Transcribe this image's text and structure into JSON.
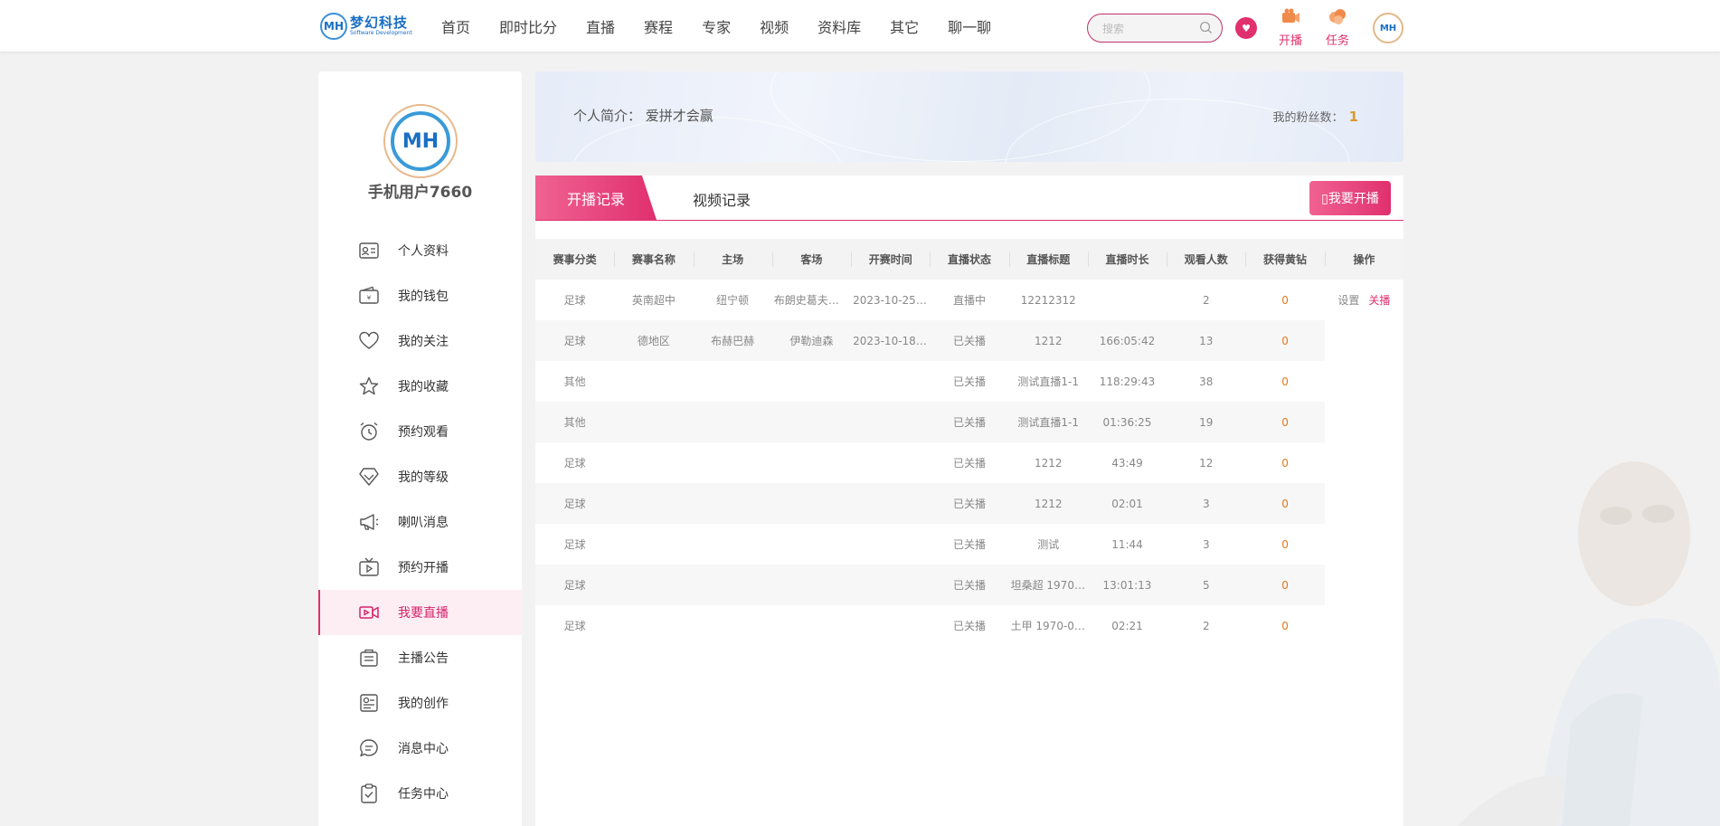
{
  "header": {
    "logo_mark": "MH",
    "logo_name": "梦幻科技",
    "logo_sub": "Software Development",
    "nav": [
      "首页",
      "即时比分",
      "直播",
      "赛程",
      "专家",
      "视频",
      "资料库",
      "其它",
      "聊一聊"
    ],
    "search_placeholder": "搜索",
    "tools": [
      {
        "label": "开播",
        "icon": "camera-icon"
      },
      {
        "label": "任务",
        "icon": "task-cloud-icon"
      }
    ],
    "avatar": "MH",
    "accent": "#e0306e"
  },
  "sidebar": {
    "avatar": "MH",
    "username": "手机用户7660",
    "items": [
      {
        "label": "个人资料",
        "icon": "id-card-icon"
      },
      {
        "label": "我的钱包",
        "icon": "wallet-icon"
      },
      {
        "label": "我的关注",
        "icon": "heart-icon"
      },
      {
        "label": "我的收藏",
        "icon": "star-icon"
      },
      {
        "label": "预约观看",
        "icon": "alarm-clock-icon"
      },
      {
        "label": "我的等级",
        "icon": "diamond-icon"
      },
      {
        "label": "喇叭消息",
        "icon": "megaphone-icon"
      },
      {
        "label": "预约开播",
        "icon": "tv-icon"
      },
      {
        "label": "我要直播",
        "icon": "video-camera-icon"
      },
      {
        "label": "主播公告",
        "icon": "notice-board-icon"
      },
      {
        "label": "我的创作",
        "icon": "creation-icon"
      },
      {
        "label": "消息中心",
        "icon": "chat-bubble-icon"
      },
      {
        "label": "任务中心",
        "icon": "clipboard-check-icon"
      }
    ],
    "active_index": 8
  },
  "banner": {
    "intro": "个人简介： 爱拼才会赢",
    "fans_label": "我的粉丝数：",
    "fans_count": "1"
  },
  "tabs": {
    "active": "开播记录",
    "other": "视频记录",
    "live_button": "▯我要开播"
  },
  "table": {
    "headers": [
      "赛事分类",
      "赛事名称",
      "主场",
      "客场",
      "开赛时间",
      "直播状态",
      "直播标题",
      "直播时长",
      "观看人数",
      "获得黄钻",
      "操作"
    ],
    "rows": [
      [
        "足球",
        "英南超中",
        "纽宁顿",
        "布朗史葛夫竞技",
        "2023-10-25 0...",
        "直播中",
        "12212312",
        "",
        "2",
        "0"
      ],
      [
        "足球",
        "德地区",
        "布赫巴赫",
        "伊勒迪森",
        "2023-10-18 0...",
        "已关播",
        "1212",
        "166:05:42",
        "13",
        "0"
      ],
      [
        "其他",
        "",
        "",
        "",
        "",
        "已关播",
        "测试直播1-1",
        "118:29:43",
        "38",
        "0"
      ],
      [
        "其他",
        "",
        "",
        "",
        "",
        "已关播",
        "测试直播1-1",
        "01:36:25",
        "19",
        "0"
      ],
      [
        "足球",
        "",
        "",
        "",
        "",
        "已关播",
        "1212",
        "43:49",
        "12",
        "0"
      ],
      [
        "足球",
        "",
        "",
        "",
        "",
        "已关播",
        "1212",
        "02:01",
        "3",
        "0"
      ],
      [
        "足球",
        "",
        "",
        "",
        "",
        "已关播",
        "测试",
        "11:44",
        "3",
        "0"
      ],
      [
        "足球",
        "",
        "",
        "",
        "",
        "已关播",
        "坦桑超 1970-...",
        "13:01:13",
        "5",
        "0"
      ],
      [
        "足球",
        "",
        "",
        "",
        "",
        "已关播",
        "土甲 1970-01...",
        "02:21",
        "2",
        "0"
      ]
    ],
    "ops": {
      "settings": "设置",
      "close": "关播"
    }
  }
}
